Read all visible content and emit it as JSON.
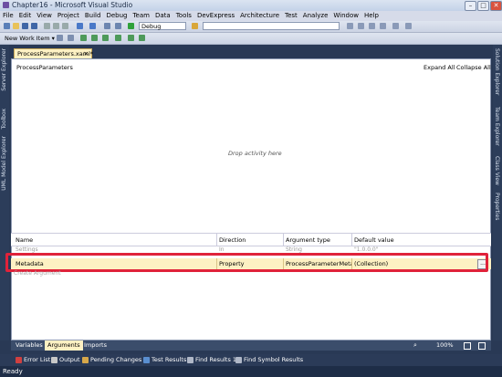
{
  "window": {
    "title": "Chapter16 - Microsoft Visual Studio"
  },
  "menu": [
    "File",
    "Edit",
    "View",
    "Project",
    "Build",
    "Debug",
    "Team",
    "Data",
    "Tools",
    "DevExpress",
    "Architecture",
    "Test",
    "Analyze",
    "Window",
    "Help"
  ],
  "toolbar": {
    "config": "Debug",
    "new_work_item": "New Work Item ▾"
  },
  "left_rail": [
    "Server Explorer",
    "Toolbox",
    "UML Model Explorer"
  ],
  "right_rail": [
    "Solution Explorer",
    "Team Explorer",
    "Class View",
    "Properties"
  ],
  "document": {
    "tab": "ProcessParameters.xaml*",
    "breadcrumb": "ProcessParameters",
    "expand_all": "Expand All",
    "collapse_all": "Collapse All",
    "drop_hint": "Drop activity here"
  },
  "grid": {
    "columns": [
      "Name",
      "Direction",
      "Argument type",
      "Default value"
    ],
    "rows": [
      [
        "Settings",
        "In",
        "String",
        "\"1.0.0.0\""
      ],
      [
        "Metadata",
        "Property",
        "ProcessParameterMetadata",
        "(Collection)"
      ]
    ],
    "create": "Create Argument",
    "ellipsis": "..."
  },
  "bottom_tabs": [
    "Variables",
    "Arguments",
    "Imports"
  ],
  "zoom": "100%",
  "tool_windows": [
    "Error List",
    "Output",
    "Pending Changes",
    "Test Results",
    "Find Results 1",
    "Find Symbol Results"
  ],
  "status": "Ready"
}
